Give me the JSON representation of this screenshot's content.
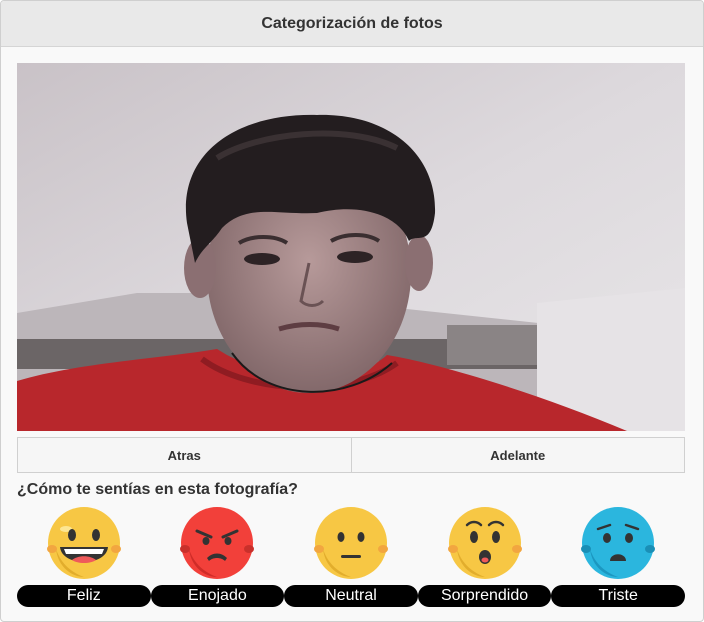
{
  "window": {
    "title": "Categorización de fotos"
  },
  "photo": {
    "description_icon": "person-photo"
  },
  "nav": {
    "back_label": "Atras",
    "forward_label": "Adelante"
  },
  "question": "¿Cómo te sentías en esta fotografía?",
  "emotions": [
    {
      "label": "Feliz",
      "icon": "happy-face-icon",
      "color": "#f7c744"
    },
    {
      "label": "Enojado",
      "icon": "angry-face-icon",
      "color": "#f2403a"
    },
    {
      "label": "Neutral",
      "icon": "neutral-face-icon",
      "color": "#f7c744"
    },
    {
      "label": "Sorprendido",
      "icon": "surprised-face-icon",
      "color": "#f7c744"
    },
    {
      "label": "Triste",
      "icon": "sad-face-icon",
      "color": "#2bb6de"
    }
  ]
}
